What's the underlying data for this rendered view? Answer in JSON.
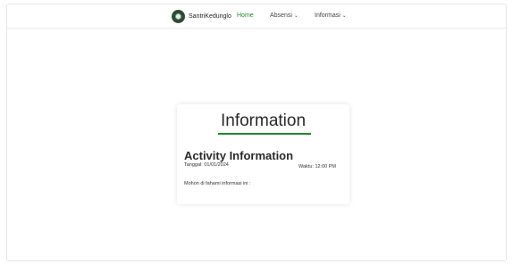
{
  "navbar": {
    "brand": "SantriKedunglo",
    "items": [
      {
        "label": "Home",
        "active": true,
        "has_dropdown": false
      },
      {
        "label": "Absensi",
        "active": false,
        "has_dropdown": true
      },
      {
        "label": "Informasi",
        "active": false,
        "has_dropdown": true
      }
    ],
    "dropdown_icon": "chevron-down-icon"
  },
  "card": {
    "title": "Information",
    "activity_title": "Activity Information",
    "date": "Tanggal: 01/01/2024",
    "time": "Waktu: 12:00 PM",
    "note": "Mohon di fahami informasi ini :"
  },
  "colors": {
    "accent": "#1e8a2e",
    "logo_bg": "#2d4b36"
  }
}
